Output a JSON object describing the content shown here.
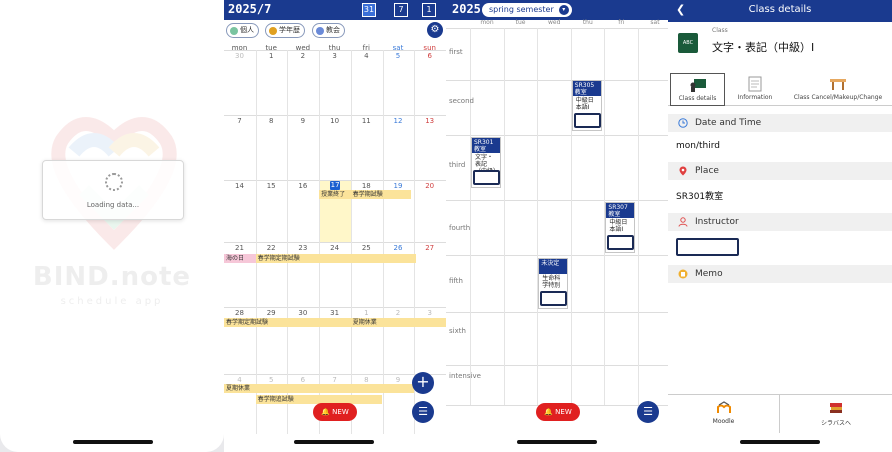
{
  "loading": {
    "message": "Loading data...",
    "brand": "BIND.note",
    "subtitle": "schedule app"
  },
  "month": {
    "title": "2025/7",
    "view_buttons": [
      "31",
      "7",
      "1"
    ],
    "filters": [
      {
        "label": "個人",
        "color": "#7ac4a0"
      },
      {
        "label": "学年歴",
        "color": "#e0a020"
      },
      {
        "label": "教会",
        "color": "#6a8ad8"
      }
    ],
    "weekdays": [
      "mon",
      "tue",
      "wed",
      "thu",
      "fri",
      "sat",
      "sun"
    ],
    "weeks": [
      [
        "30",
        "1",
        "2",
        "3",
        "4",
        "5",
        "6"
      ],
      [
        "7",
        "8",
        "9",
        "10",
        "11",
        "12",
        "13"
      ],
      [
        "14",
        "15",
        "16",
        "17",
        "18",
        "19",
        "20"
      ],
      [
        "21",
        "22",
        "23",
        "24",
        "25",
        "26",
        "27"
      ],
      [
        "28",
        "29",
        "30",
        "31",
        "1",
        "2",
        "3"
      ],
      [
        "4",
        "5",
        "6",
        "7",
        "8",
        "9",
        "10"
      ]
    ],
    "events": [
      {
        "label": "授業終了",
        "color": "#fbe39a"
      },
      {
        "label": "春学期試験",
        "color": "#fbe39a"
      },
      {
        "label": "海の日",
        "color": "#f6c7d8"
      },
      {
        "label": "春学期定期試験",
        "color": "#fbe39a"
      },
      {
        "label": "春学期定期試験",
        "color": "#fbe39a"
      },
      {
        "label": "夏期休業",
        "color": "#fbe39a"
      },
      {
        "label": "夏期休業",
        "color": "#fbe39a"
      },
      {
        "label": "春学期追試験",
        "color": "#fbe39a"
      }
    ],
    "new_label": "🔔 NEW"
  },
  "week": {
    "year": "2025",
    "semester": "spring semester",
    "weekdays": [
      "mon",
      "tue",
      "wed",
      "thu",
      "fri",
      "sat"
    ],
    "periods": [
      "first",
      "second",
      "third",
      "fourth",
      "fifth",
      "sixth",
      "intensive"
    ],
    "classes": [
      {
        "room": "SR305教室",
        "name": "中級日本語Ⅰ"
      },
      {
        "room": "SR301教室",
        "name": "文字・表記（中級）"
      },
      {
        "room": "SR307教室",
        "name": "中級日本語Ⅰ"
      },
      {
        "room": "未決定",
        "name": "生命科学特別"
      }
    ],
    "new_label": "🔔 NEW"
  },
  "details": {
    "header": "Class details",
    "class_label": "Class",
    "class_name": "文字・表記（中級）Ⅰ",
    "tabs": [
      "Class details",
      "Information",
      "Class Cancel/Makeup/Change"
    ],
    "sections": {
      "date_title": "Date and Time",
      "date_value": "mon/third",
      "place_title": "Place",
      "place_value": "SR301教室",
      "instructor_title": "Instructor",
      "memo_title": "Memo"
    },
    "bottom": [
      "Moodle",
      "シラバスへ"
    ]
  }
}
